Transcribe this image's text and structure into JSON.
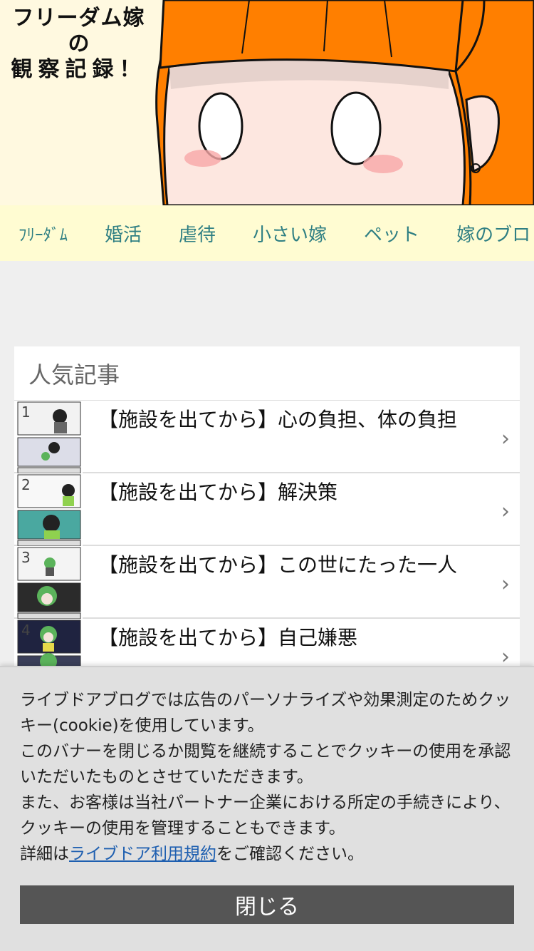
{
  "header": {
    "title_line1": "フリーダム嫁",
    "title_line2": "の",
    "title_line3": "観察記録！"
  },
  "nav": {
    "items": [
      "ﾌﾘｰﾀﾞﾑ",
      "婚活",
      "虐待",
      "小さい嫁",
      "ペット",
      "嫁のブロ"
    ]
  },
  "popular": {
    "title": "人気記事",
    "articles": [
      {
        "rank": "1",
        "title": "【施設を出てから】心の負担、体の負担"
      },
      {
        "rank": "2",
        "title": "【施設を出てから】解決策"
      },
      {
        "rank": "3",
        "title": "【施設を出てから】この世にたった一人"
      },
      {
        "rank": "4",
        "title": "【施設を出てから】自己嫌悪"
      }
    ]
  },
  "cookie": {
    "line1": "ライブドアブログでは広告のパーソナライズや効果測定のためクッキー(cookie)を使用しています。",
    "line2": "このバナーを閉じるか閲覧を継続することでクッキーの使用を承認いただいたものとさせていただきます。",
    "line3": "また、お客様は当社パートナー企業における所定の手続きにより、クッキーの使用を管理することもできます。",
    "detail_prefix": "詳細は",
    "link_text": "ライブドア利用規約",
    "detail_suffix": "をご確認ください。",
    "close_label": "閉じる"
  },
  "colors": {
    "nav_bg": "#fffcd2",
    "nav_text": "#2f7f83",
    "hair": "#ff7f00",
    "link": "#1e5fb0",
    "close_bg": "#555555"
  }
}
